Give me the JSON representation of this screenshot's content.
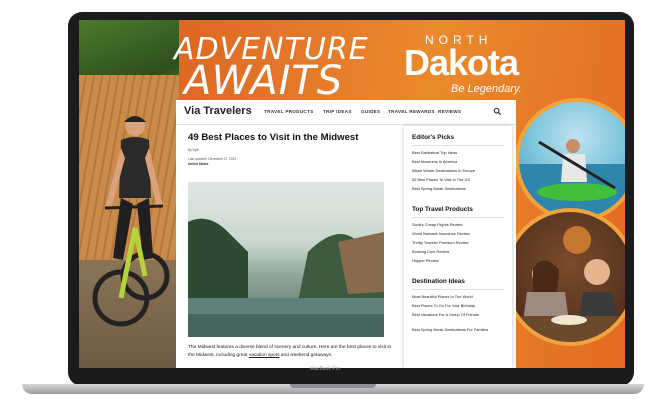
{
  "device": {
    "label": "MacBook Pro"
  },
  "banner": {
    "headline_line1": "ADVENTURE",
    "headline_line2": "AWAITS",
    "brand_top": "NORTH",
    "brand_main": "Dakota",
    "brand_tagline": "Be Legendary."
  },
  "site": {
    "logo": "Via Travelers",
    "nav": [
      "TRAVEL PRODUCTS",
      "TRIP IDEAS",
      "GUIDES",
      "TRAVEL REWARDS",
      "REVIEWS"
    ]
  },
  "article": {
    "title": "49 Best Places to Visit in the Midwest",
    "byline": "By Kyle",
    "updated": "Last updated: December 27, 2023",
    "location": "United States",
    "excerpt_before": "The Midwest features a diverse blend of scenery and culture. Here are the best places to visit in the Midwest, including great ",
    "excerpt_link": "vacation spots",
    "excerpt_after": " and weekend getaways."
  },
  "sidebar": {
    "sections": [
      {
        "heading": "Editor's Picks",
        "items": [
          "Best Sabbatical Trip Ideas",
          "Best Museums In America",
          "Warm Winter Destinations In Europe",
          "50 Best Places To Visit In The US",
          "Best Spring Break Destinations"
        ]
      },
      {
        "heading": "Top Travel Products",
        "items": [
          "Scott's Cheap Flights Review",
          "World Nomads Insurance Review",
          "Thrifty Traveler Premium Review",
          "Booking.Com Review",
          "Hopper Review"
        ]
      },
      {
        "heading": "Destination Ideas",
        "items": [
          "Most Beautiful Places In The World",
          "Best Places To Go For Your Birthday",
          "Best Vacations For A Group Of Friends",
          "Best Spring Break Destinations For Families"
        ]
      }
    ]
  }
}
